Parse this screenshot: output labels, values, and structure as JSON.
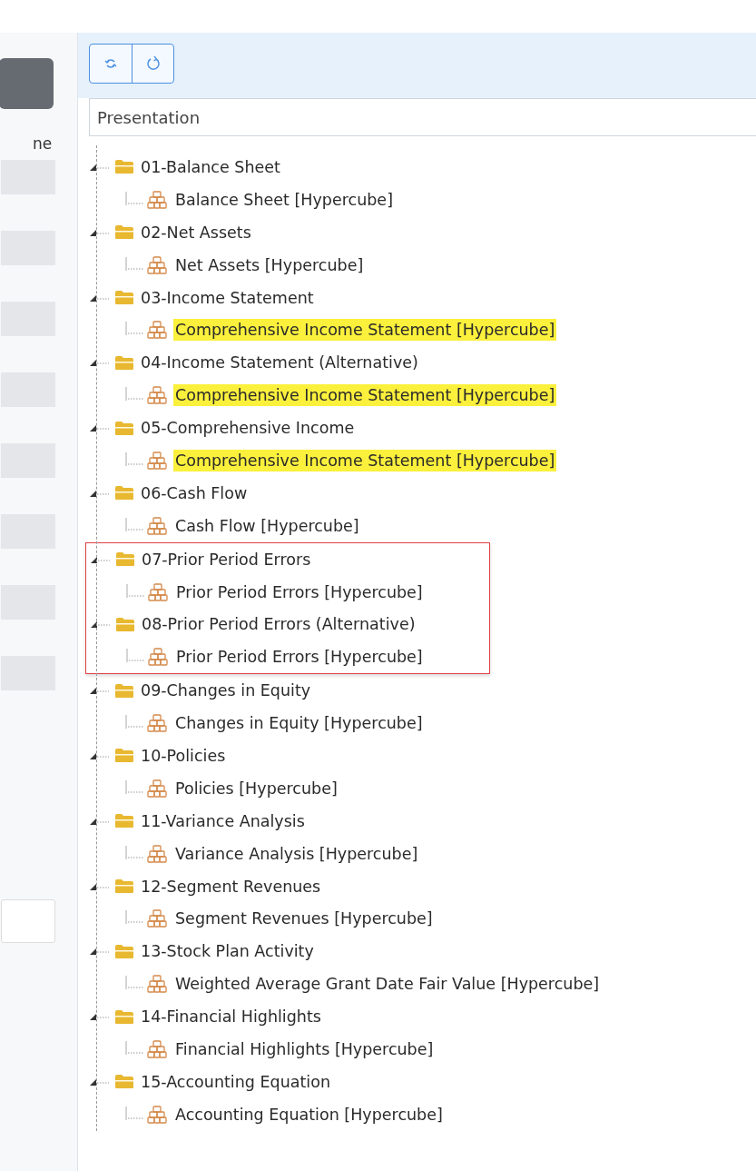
{
  "left_panel": {
    "label": "ne"
  },
  "toolbar": {
    "buttons": [
      {
        "kind": "collapse"
      },
      {
        "kind": "refresh"
      }
    ]
  },
  "network_select": {
    "value": "Presentation"
  },
  "tree": [
    {
      "label": "01-Balance Sheet",
      "expanded": true,
      "outlined": false,
      "children": [
        {
          "label": "Balance Sheet [Hypercube]",
          "highlighted": false
        }
      ]
    },
    {
      "label": "02-Net Assets",
      "expanded": true,
      "outlined": false,
      "children": [
        {
          "label": "Net Assets [Hypercube]",
          "highlighted": false
        }
      ]
    },
    {
      "label": "03-Income Statement",
      "expanded": true,
      "outlined": false,
      "children": [
        {
          "label": "Comprehensive Income Statement [Hypercube]",
          "highlighted": true
        }
      ]
    },
    {
      "label": "04-Income Statement (Alternative)",
      "expanded": true,
      "outlined": false,
      "children": [
        {
          "label": "Comprehensive Income Statement [Hypercube]",
          "highlighted": true
        }
      ]
    },
    {
      "label": "05-Comprehensive Income",
      "expanded": true,
      "outlined": false,
      "children": [
        {
          "label": "Comprehensive Income Statement [Hypercube]",
          "highlighted": true
        }
      ]
    },
    {
      "label": "06-Cash Flow",
      "expanded": true,
      "outlined": false,
      "children": [
        {
          "label": "Cash Flow [Hypercube]",
          "highlighted": false
        }
      ]
    },
    {
      "label": "07-Prior Period Errors",
      "expanded": true,
      "outlined": true,
      "children": [
        {
          "label": "Prior Period Errors [Hypercube]",
          "highlighted": false
        }
      ]
    },
    {
      "label": "08-Prior Period Errors (Alternative)",
      "expanded": true,
      "outlined": true,
      "children": [
        {
          "label": "Prior Period Errors [Hypercube]",
          "highlighted": false
        }
      ]
    },
    {
      "label": "09-Changes in Equity",
      "expanded": true,
      "outlined": false,
      "children": [
        {
          "label": "Changes in Equity [Hypercube]",
          "highlighted": false
        }
      ]
    },
    {
      "label": "10-Policies",
      "expanded": true,
      "outlined": false,
      "children": [
        {
          "label": "Policies [Hypercube]",
          "highlighted": false
        }
      ]
    },
    {
      "label": "11-Variance Analysis",
      "expanded": true,
      "outlined": false,
      "children": [
        {
          "label": "Variance Analysis [Hypercube]",
          "highlighted": false
        }
      ]
    },
    {
      "label": "12-Segment Revenues",
      "expanded": true,
      "outlined": false,
      "children": [
        {
          "label": "Segment Revenues [Hypercube]",
          "highlighted": false
        }
      ]
    },
    {
      "label": "13-Stock Plan Activity",
      "expanded": true,
      "outlined": false,
      "children": [
        {
          "label": "Weighted Average Grant Date Fair Value [Hypercube]",
          "highlighted": false
        }
      ]
    },
    {
      "label": "14-Financial Highlights",
      "expanded": true,
      "outlined": false,
      "children": [
        {
          "label": "Financial Highlights [Hypercube]",
          "highlighted": false
        }
      ]
    },
    {
      "label": "15-Accounting Equation",
      "expanded": true,
      "outlined": false,
      "children": [
        {
          "label": "Accounting Equation [Hypercube]",
          "highlighted": false
        }
      ]
    }
  ]
}
